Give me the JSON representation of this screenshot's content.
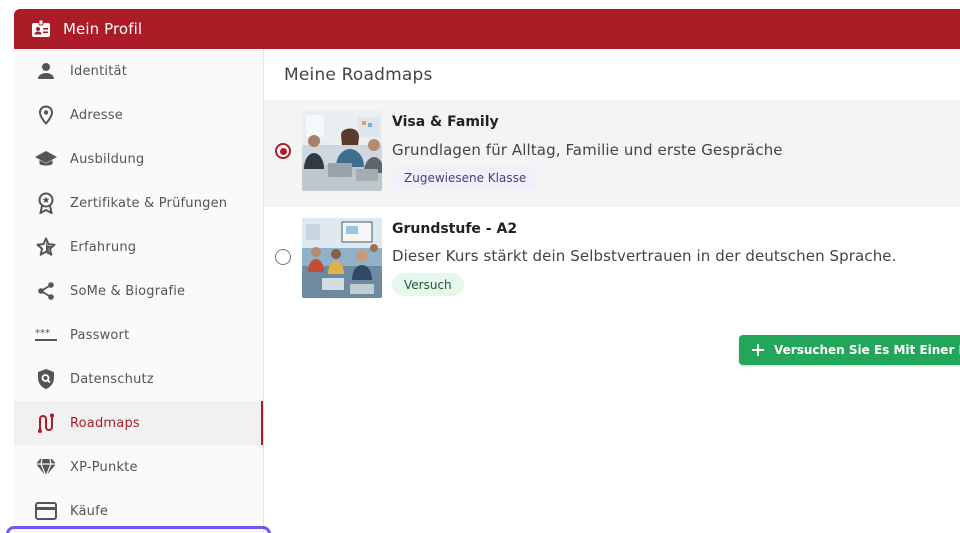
{
  "header": {
    "title": "Mein Profil",
    "icon": "id-badge-icon"
  },
  "sidebar": {
    "items": [
      {
        "label": "Identität",
        "icon": "person-icon"
      },
      {
        "label": "Adresse",
        "icon": "location-pin-icon"
      },
      {
        "label": "Ausbildung",
        "icon": "graduation-cap-icon"
      },
      {
        "label": "Zertifikate & Prüfungen",
        "icon": "award-ribbon-icon"
      },
      {
        "label": "Erfahrung",
        "icon": "star-icon"
      },
      {
        "label": "SoMe & Biografie",
        "icon": "share-icon"
      },
      {
        "label": "Passwort",
        "icon": "password-icon"
      },
      {
        "label": "Datenschutz",
        "icon": "shield-search-icon"
      },
      {
        "label": "Roadmaps",
        "icon": "route-icon",
        "active": true
      },
      {
        "label": "XP-Punkte",
        "icon": "diamond-icon"
      },
      {
        "label": "Käufe",
        "icon": "credit-card-icon"
      }
    ]
  },
  "main": {
    "title": "Meine Roadmaps",
    "roadmaps": [
      {
        "title": "Visa & Family",
        "description": "Grundlagen für Alltag, Familie und erste Gespräche",
        "badge": "Zugewiesene Klasse",
        "selected": true
      },
      {
        "title": "Grundstufe - A2",
        "description": "Dieser Kurs stärkt dein Selbstvertrauen in der deutschen Sprache.",
        "badge": "Versuch",
        "selected": false
      }
    ],
    "try_button": "Versuchen Sie Es Mit Einer Road"
  },
  "colors": {
    "brand_red": "#ac1c26",
    "green_button": "#22a659",
    "focus_outline": "#6a5af2"
  }
}
